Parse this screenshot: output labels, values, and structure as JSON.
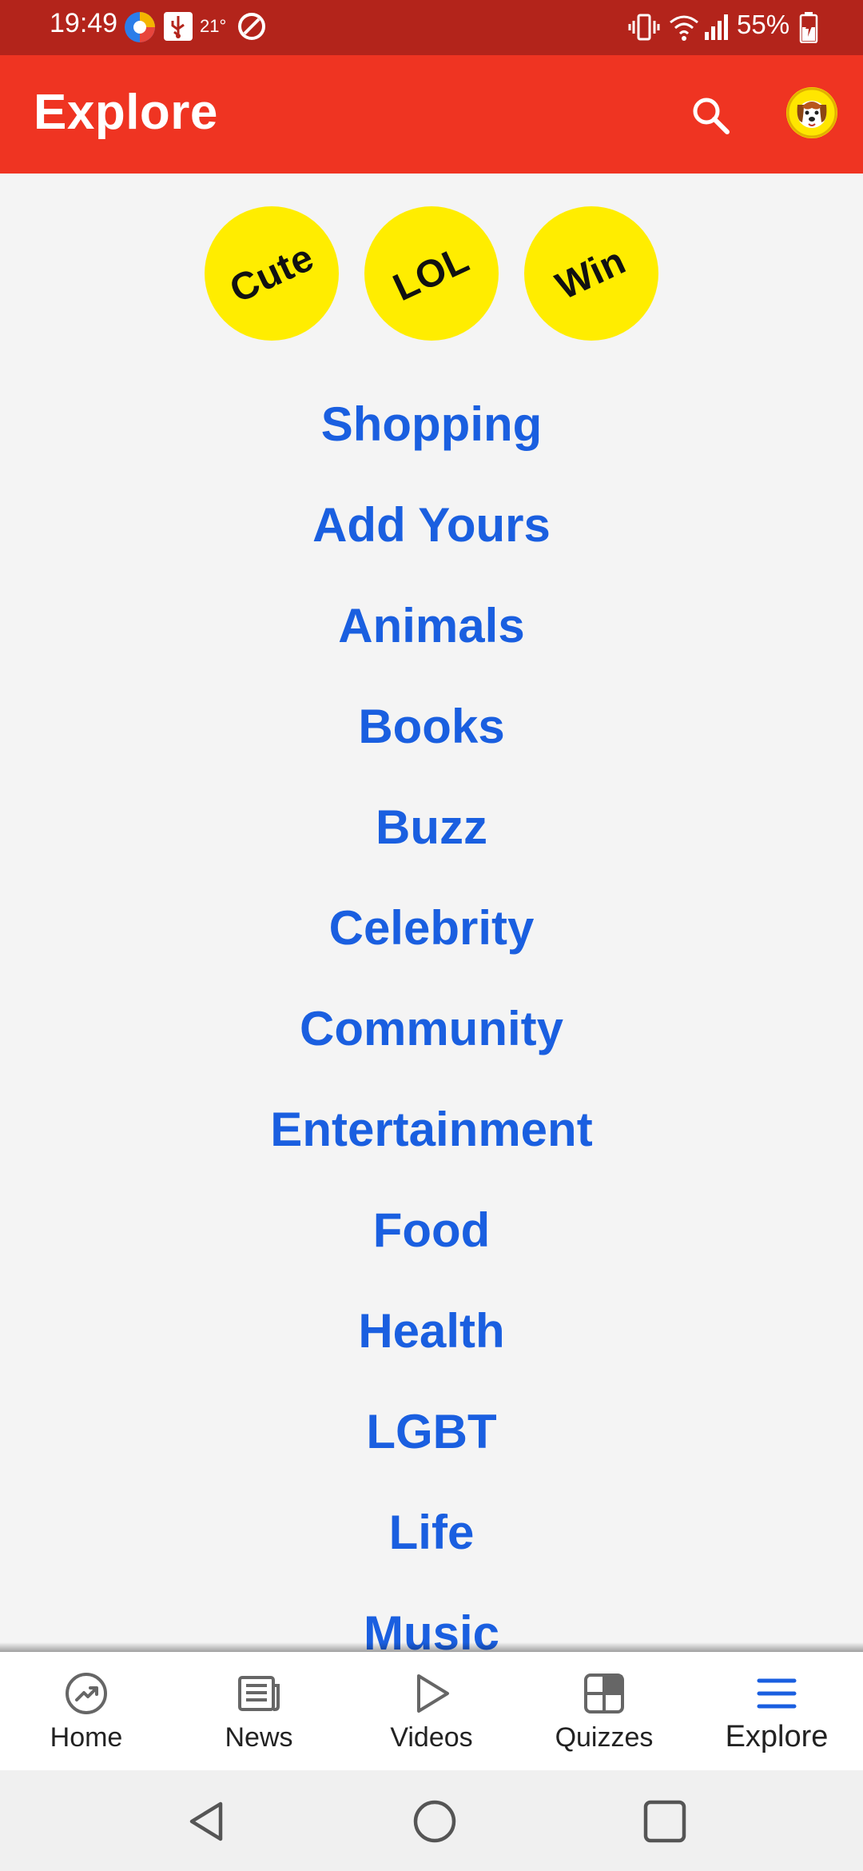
{
  "status_bar": {
    "time": "19:49",
    "temperature": "21°",
    "battery": "55%"
  },
  "app_bar": {
    "title": "Explore"
  },
  "badges": [
    "Cute",
    "LOL",
    "Win"
  ],
  "categories": [
    "Shopping",
    "Add Yours",
    "Animals",
    "Books",
    "Buzz",
    "Celebrity",
    "Community",
    "Entertainment",
    "Food",
    "Health",
    "LGBT",
    "Life",
    "Music"
  ],
  "bottom_nav": {
    "items": [
      {
        "label": "Home",
        "icon": "trending-icon"
      },
      {
        "label": "News",
        "icon": "newspaper-icon"
      },
      {
        "label": "Videos",
        "icon": "play-icon"
      },
      {
        "label": "Quizzes",
        "icon": "grid-icon"
      },
      {
        "label": "Explore",
        "icon": "menu-icon"
      }
    ],
    "active": "Explore"
  },
  "colors": {
    "status_bar": "#b3241b",
    "app_bar": "#ef3422",
    "link": "#1a5fe0",
    "badge": "#ffed00",
    "active_nav": "#1a5fe0"
  }
}
